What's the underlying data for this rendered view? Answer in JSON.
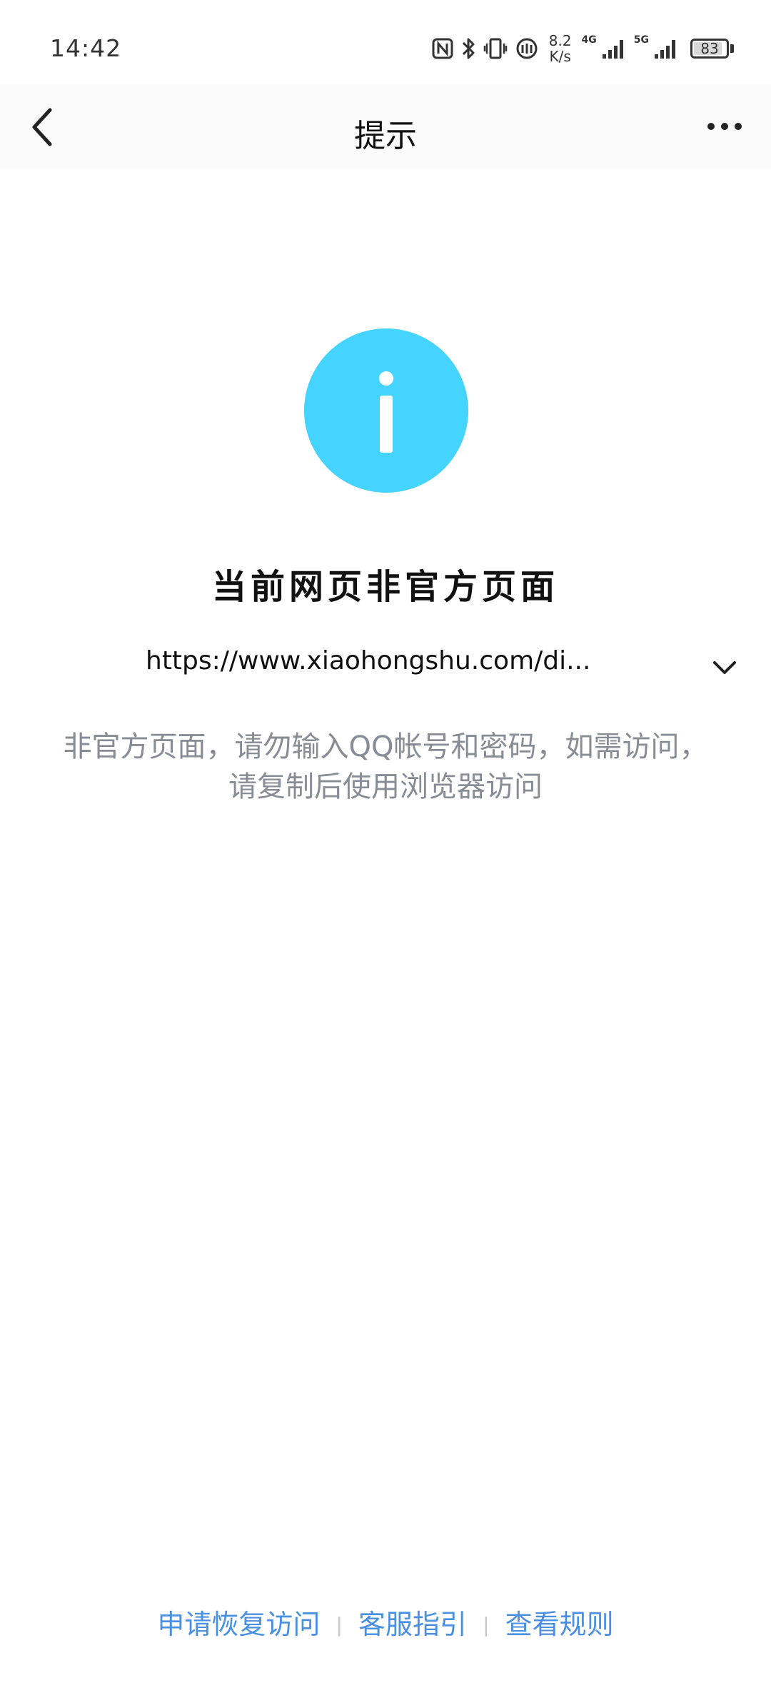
{
  "status_bar": {
    "time": "14:42",
    "speed_value": "8.2",
    "speed_unit": "K/s",
    "sim1_label": "4G",
    "sim2_label": "5G",
    "battery_level": "83",
    "icons": [
      "nfc-icon",
      "bluetooth-icon",
      "vibrate-icon",
      "wifi-calling-icon",
      "signal-icon",
      "signal-icon",
      "battery-icon"
    ]
  },
  "nav": {
    "title": "提示",
    "back_icon": "chevron-left-icon",
    "more_icon": "more-dots-icon"
  },
  "main": {
    "icon": "info-icon",
    "icon_color": "#45d3ff",
    "headline": "当前网页非官方页面",
    "url": "https://www.xiaohongshu.com/di...",
    "url_toggle_icon": "chevron-down-icon",
    "warning_line1": "非官方页面，请勿输入QQ帐号和密码，如需访问，",
    "warning_line2": "请复制后使用浏览器访问"
  },
  "footer": {
    "link_color": "#4a90e2",
    "links": [
      "申请恢复访问",
      "客服指引",
      "查看规则"
    ],
    "separator": "|"
  }
}
